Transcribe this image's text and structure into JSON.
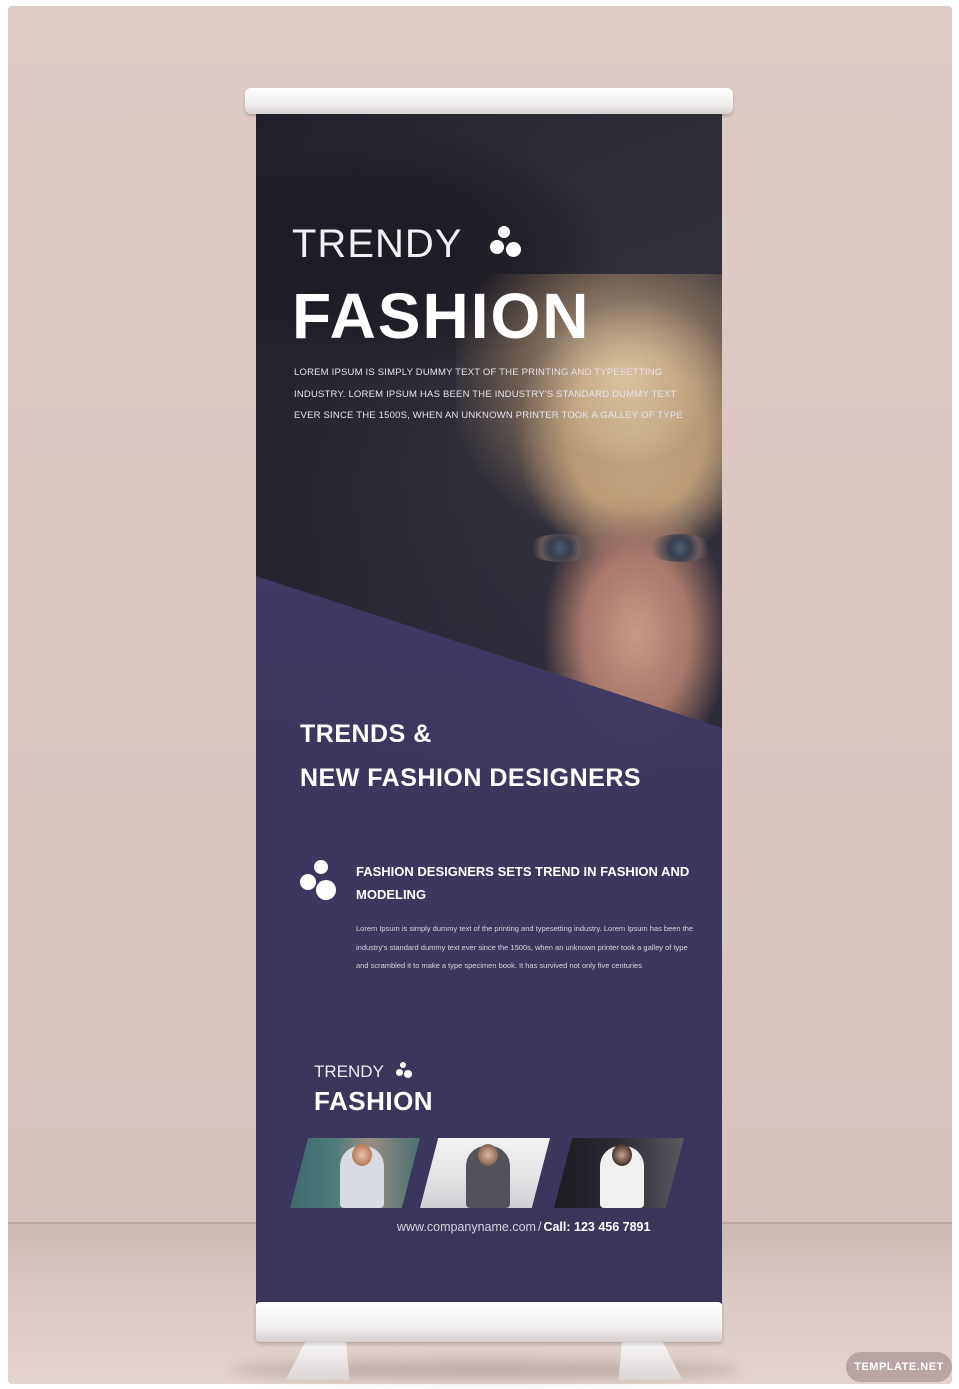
{
  "banner": {
    "title_light": "TRENDY",
    "title_bold": "FASHION",
    "intro": "LOREM IPSUM IS SIMPLY DUMMY TEXT OF THE PRINTING AND TYPESETTING INDUSTRY. LOREM IPSUM HAS BEEN THE INDUSTRY'S STANDARD DUMMY TEXT EVER SINCE THE 1500S, WHEN AN UNKNOWN PRINTER TOOK A GALLEY OF TYPE",
    "headline_line1": "TRENDS &",
    "headline_line2": "NEW FASHION DESIGNERS",
    "subheading": "FASHION DESIGNERS SETS TREND IN FASHION AND MODELING",
    "body": "Lorem Ipsum is simply dummy text of the printing and typesetting industry. Lorem Ipsum has been the industry's standard dummy text ever since the 1500s, when an unknown printer took a galley of type and scrambled it to make a type specimen book. It has survived not only five centuries",
    "logo_light": "TRENDY",
    "logo_bold": "FASHION",
    "website": "www.companyname.com",
    "separator": "/",
    "phone": "Call: 123 456 7891"
  },
  "watermark": "TEMPLATE.NET",
  "colors": {
    "banner_purple": "#3e3862",
    "background": "#ddcbc6",
    "text_white": "#ffffff"
  }
}
